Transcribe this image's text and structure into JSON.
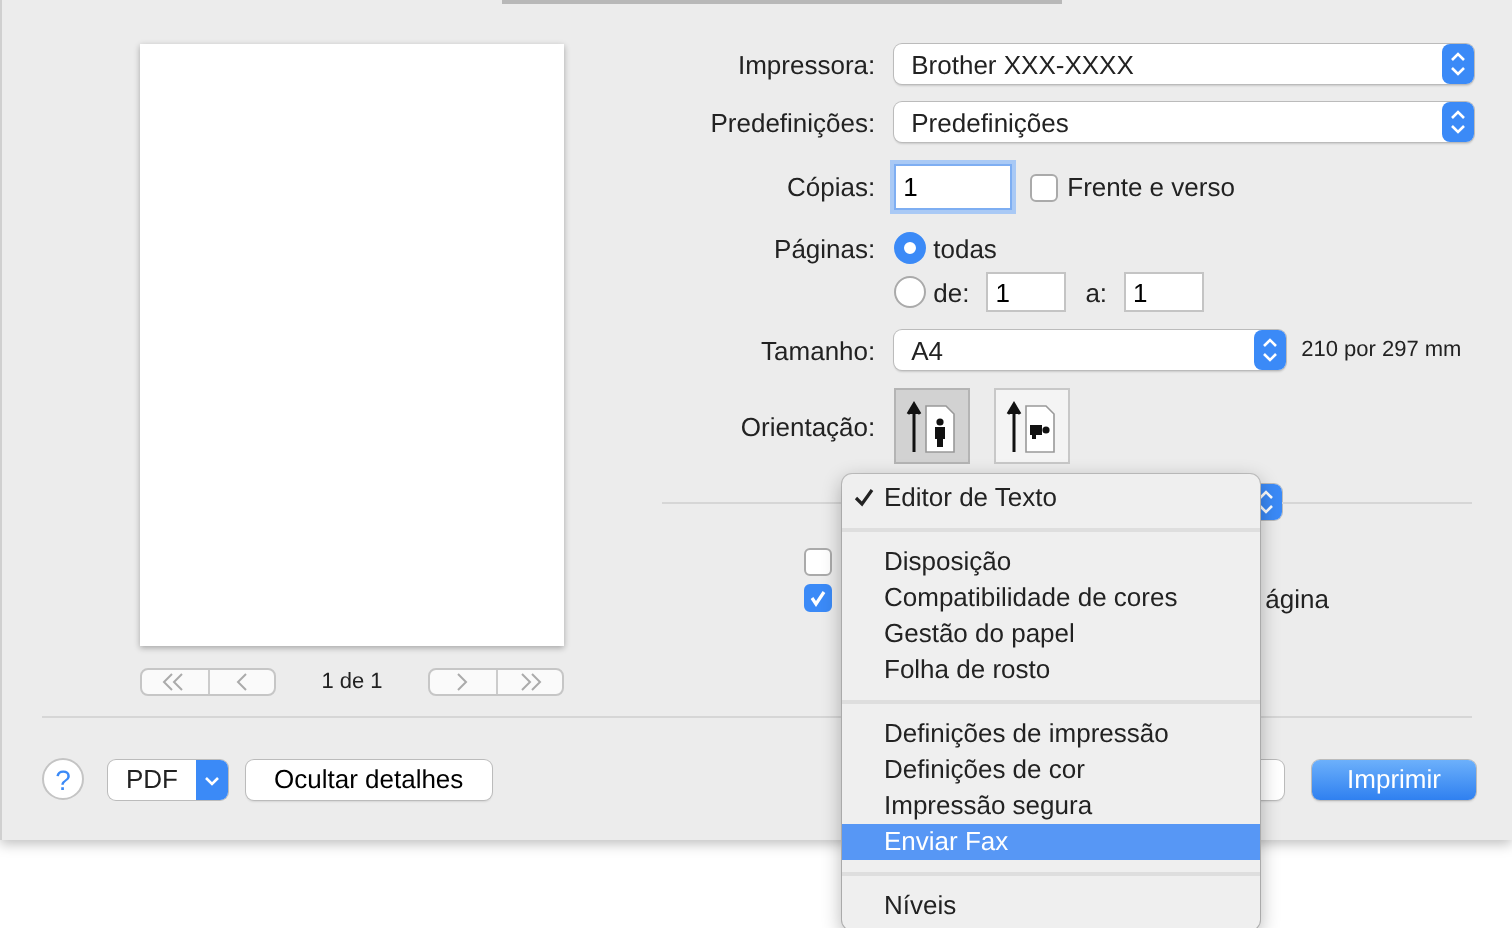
{
  "preview": {
    "page_counter": "1 de 1"
  },
  "form": {
    "printer": {
      "label": "Impressora:",
      "value": "Brother XXX-XXXX"
    },
    "presets": {
      "label": "Predefinições:",
      "value": "Predefinições"
    },
    "copies": {
      "label": "Cópias:",
      "value": "1"
    },
    "two_sided": {
      "label": "Frente e verso",
      "checked": false
    },
    "pages": {
      "label": "Páginas:",
      "options": [
        {
          "label": "todas",
          "selected": true
        },
        {
          "label": "de:",
          "selected": false
        }
      ],
      "from": "1",
      "to_label": "a:",
      "to": "1"
    },
    "paper_size": {
      "label": "Tamanho:",
      "value": "A4",
      "dimensions": "210 por 297 mm"
    },
    "orientation": {
      "label": "Orientação:",
      "options": [
        {
          "kind": "portrait",
          "selected": true
        },
        {
          "kind": "landscape",
          "selected": false
        }
      ]
    }
  },
  "pane_options": [
    {
      "checked": false
    },
    {
      "checked": true,
      "label_end": "ágina"
    }
  ],
  "footer": {
    "help": "?",
    "pdf": "PDF",
    "hide_details": "Ocultar detalhes",
    "print": "Imprimir"
  },
  "menu": {
    "items": [
      {
        "kind": "item",
        "label": "Editor de Texto",
        "checked": true,
        "selected": false
      },
      {
        "kind": "separator"
      },
      {
        "kind": "item",
        "label": "Disposição",
        "checked": false,
        "selected": false
      },
      {
        "kind": "item",
        "label": "Compatibilidade de cores",
        "checked": false,
        "selected": false
      },
      {
        "kind": "item",
        "label": "Gestão do papel",
        "checked": false,
        "selected": false
      },
      {
        "kind": "item",
        "label": "Folha de rosto",
        "checked": false,
        "selected": false
      },
      {
        "kind": "separator"
      },
      {
        "kind": "item",
        "label": "Definições de impressão",
        "checked": false,
        "selected": false
      },
      {
        "kind": "item",
        "label": "Definições de cor",
        "checked": false,
        "selected": false
      },
      {
        "kind": "item",
        "label": "Impressão segura",
        "checked": false,
        "selected": false
      },
      {
        "kind": "item",
        "label": "Enviar Fax",
        "checked": false,
        "selected": true
      },
      {
        "kind": "separator"
      },
      {
        "kind": "item",
        "label": "Níveis",
        "checked": false,
        "selected": false
      }
    ]
  }
}
